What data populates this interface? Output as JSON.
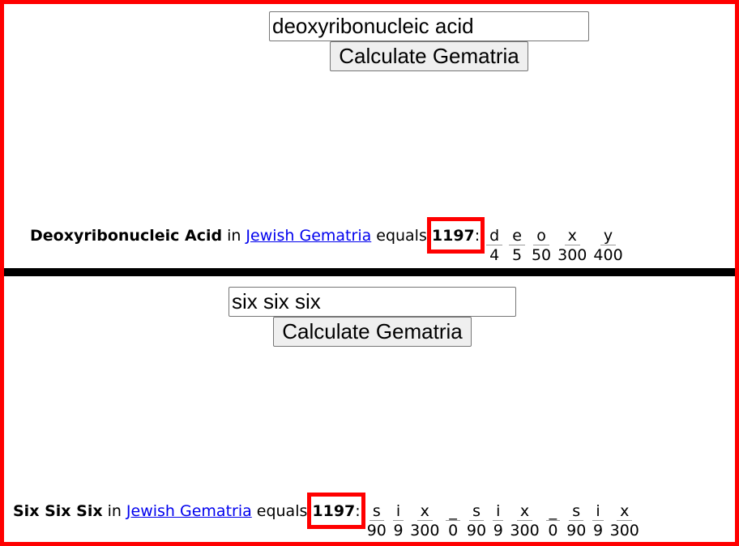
{
  "panels": [
    {
      "input_value": "deoxyribonucleic acid",
      "button_label": "Calculate Gematria",
      "phrase": "Deoxyribonucleic Acid",
      "in_text": "in",
      "system_link": "Jewish Gematria",
      "equals_text": "equals",
      "total": "1197",
      "letters": [
        {
          "ch": "d",
          "val": "4"
        },
        {
          "ch": "e",
          "val": "5"
        },
        {
          "ch": "o",
          "val": "50"
        },
        {
          "ch": "x",
          "val": "300"
        },
        {
          "ch": "y",
          "val": "400"
        }
      ]
    },
    {
      "input_value": "six six six",
      "button_label": "Calculate Gematria",
      "phrase": "Six Six Six",
      "in_text": "in",
      "system_link": "Jewish Gematria",
      "equals_text": "equals",
      "total": "1197",
      "letters": [
        {
          "ch": "s",
          "val": "90"
        },
        {
          "ch": "i",
          "val": "9"
        },
        {
          "ch": "x",
          "val": "300"
        },
        {
          "ch": "_",
          "val": "0"
        },
        {
          "ch": "s",
          "val": "90"
        },
        {
          "ch": "i",
          "val": "9"
        },
        {
          "ch": "x",
          "val": "300"
        },
        {
          "ch": "_",
          "val": "0"
        },
        {
          "ch": "s",
          "val": "90"
        },
        {
          "ch": "i",
          "val": "9"
        },
        {
          "ch": "x",
          "val": "300"
        }
      ]
    }
  ],
  "colors": {
    "frame": "#ff0000",
    "highlight": "#ff0000",
    "divider": "#000000",
    "link": "#0000ee"
  }
}
